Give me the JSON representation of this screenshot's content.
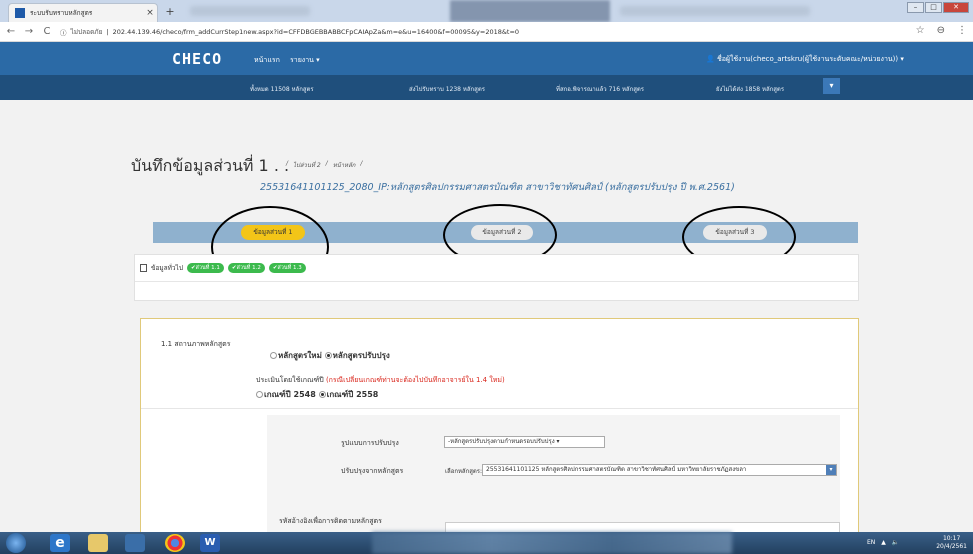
{
  "browser": {
    "tab_title": "ระบบรับทราบหลักสูตร",
    "tab_close": "×",
    "new_tab": "+",
    "nav_back": "←",
    "nav_forward": "→",
    "nav_reload": "C",
    "security_label": "ไม่ปลอดภัย",
    "url": "202.44.139.46/checo/frm_addCurrStep1new.aspx?id=CFFDBGEBBABBCFpCAIApZa&m=e&u=16400&f=00095&y=2018&t=0",
    "star": "☆",
    "menu": "⋮",
    "account": "⊖"
  },
  "header": {
    "logo": "CHECO",
    "menu_home": "หน้าแรก",
    "menu_report": "รายงาน ▾",
    "user_label": "👤 ชื่อผู้ใช้งาน(checo_artskru(ผู้ใช้งานระดับคณะ/หน่วยงาน)) ▾"
  },
  "stats": [
    "ทั้งหมด 11508 หลักสูตร",
    "ส่งไปรับทราบ 1238 หลักสูตร",
    "ที่สกอ.พิจารณาแล้ว 716 หลักสูตร",
    "ยังไม่ได้ส่ง 1858 หลักสูตร"
  ],
  "stats_toggle": "▾",
  "page": {
    "title": "บันทึกข้อมูลส่วนที่ 1",
    "title_dots": ". .",
    "crumbs": [
      "/",
      "ไปส่วนที่ 2",
      "/",
      "หน้าหลัก",
      "/"
    ],
    "subtitle": "25531641101125_2080_IP:หลักสูตรศิลปกรรมศาสตรบัณฑิต สาขาวิชาทัศนศิลป์ (หลักสูตรปรับปรุง ปี พ.ศ.2561)"
  },
  "steps": [
    "ข้อมูลส่วนที่ 1",
    "ข้อมูลส่วนที่ 2",
    "ข้อมูลส่วนที่ 3"
  ],
  "info": {
    "label": "ข้อมูลทั่วไป",
    "badges": [
      "✔ส่วนที่ 1.1",
      "✔ส่วนที่ 1.2",
      "✔ส่วนที่ 1.3"
    ]
  },
  "form": {
    "section_label": "1.1 สถานภาพหลักสูตร",
    "status_options": [
      "หลักสูตรใหม่",
      "หลักสูตรปรับปรุง"
    ],
    "eval_text": "ประเมินโดยใช้เกณฑ์ปี",
    "eval_note": "(กรณีเปลี่ยนเกณฑ์ท่านจะต้องไปบันทึกอาจารย์ใน 1.4 ใหม่)",
    "year_options": [
      "เกณฑ์ปี 2548",
      "เกณฑ์ปี 2558"
    ],
    "improve_type_label": "รูปแบบการปรับปรุง",
    "improve_type_value": "-หลักสูตรปรับปรุงตามกำหนดรอบปรับปรุง ▾",
    "improve_from_label": "ปรับปรุงจากหลักสูตร",
    "select_label": "เลือกหลักสูตร:",
    "select_value": "25531641101125 หลักสูตรศิลปกรรมศาสตรบัณฑิต สาขาวิชาทัศนศิลป์ มหาวิทยาลัยราชภัฏสงขลา",
    "combo_btn": "▾",
    "ref_label": "รหัสอ้างอิงเพื่อการติดตามหลักสูตร"
  },
  "taskbar": {
    "ie": "e",
    "word": "W",
    "tray": [
      "EN",
      "▲",
      "🔈"
    ],
    "time": "10:17",
    "date": "20/4/2561"
  }
}
